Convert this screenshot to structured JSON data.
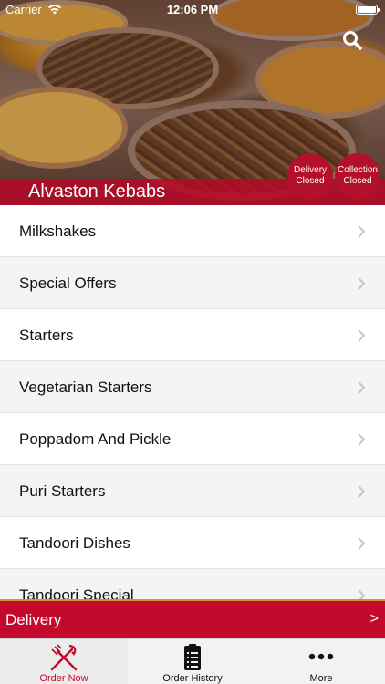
{
  "status_bar": {
    "carrier": "Carrier",
    "time": "12:06 PM"
  },
  "header": {
    "restaurant_name": "Alvaston Kebabs",
    "search_icon": "search-icon",
    "delivery_status": {
      "line1": "Delivery",
      "line2": "Closed"
    },
    "collection_status": {
      "line1": "Collection",
      "line2": "Closed"
    }
  },
  "categories": [
    {
      "label": "Milkshakes"
    },
    {
      "label": "Special Offers"
    },
    {
      "label": "Starters"
    },
    {
      "label": "Vegetarian Starters"
    },
    {
      "label": "Poppadom And Pickle"
    },
    {
      "label": "Puri Starters"
    },
    {
      "label": "Tandoori Dishes"
    },
    {
      "label": "Tandoori Special"
    }
  ],
  "order_bar": {
    "label": "Delivery",
    "arrow": ">"
  },
  "tabbar": {
    "tabs": [
      {
        "label": "Order Now",
        "icon": "fork-knife-icon",
        "active": true
      },
      {
        "label": "Order History",
        "icon": "clipboard-icon",
        "active": false
      },
      {
        "label": "More",
        "icon": "more-dots-icon",
        "active": false
      }
    ]
  },
  "colors": {
    "accent": "#c30a2d",
    "tab_active": "#c30a2d"
  }
}
